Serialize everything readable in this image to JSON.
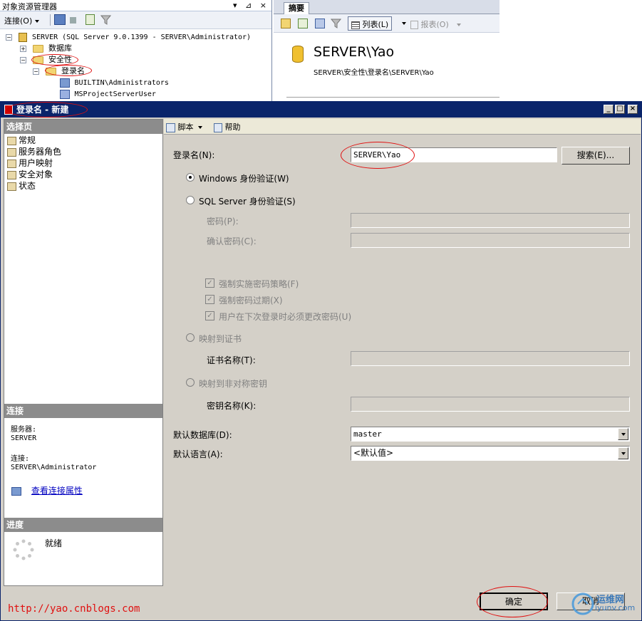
{
  "object_explorer": {
    "title": "对象资源管理器",
    "title_controls": "▾ ⊿ ×",
    "connect_label": "连接(O)",
    "tree": {
      "server": "SERVER (SQL Server 9.0.1399 - SERVER\\Administrator)",
      "databases": "数据库",
      "security": "安全性",
      "logins": "登录名",
      "login1": "BUILTIN\\Administrators",
      "login2": "MSProjectServerUser"
    }
  },
  "summary": {
    "tab_label": "摘要",
    "list_label": "列表(L)",
    "report_label": "报表(O)",
    "heading": "SERVER\\Yao",
    "path": "SERVER\\安全性\\登录名\\SERVER\\Yao"
  },
  "dialog": {
    "title": "登录名 - 新建",
    "select_page_header": "选择页",
    "pages": [
      "常规",
      "服务器角色",
      "用户映射",
      "安全对象",
      "状态"
    ],
    "connection_header": "连接",
    "server_label": "服务器:",
    "server_value": "SERVER",
    "connection_label": "连接:",
    "connection_value": "SERVER\\Administrator",
    "view_conn_props": "查看连接属性",
    "progress_header": "进度",
    "progress_status": "就绪",
    "toolbar": {
      "script_label": "脚本",
      "help_label": "帮助"
    },
    "form": {
      "login_name_label": "登录名(N):",
      "login_name_value": "SERVER\\Yao",
      "search_button": "搜索(E)...",
      "windows_auth": "Windows 身份验证(W)",
      "sql_auth": "SQL Server 身份验证(S)",
      "password_label": "密码(P):",
      "confirm_password_label": "确认密码(C):",
      "enforce_policy": "强制实施密码策略(F)",
      "enforce_expiration": "强制密码过期(X)",
      "must_change": "用户在下次登录时必须更改密码(U)",
      "map_cert": "映射到证书",
      "cert_name_label": "证书名称(T):",
      "map_asym_key": "映射到非对称密钥",
      "key_name_label": "密钥名称(K):",
      "default_db_label": "默认数据库(D):",
      "default_db_value": "master",
      "default_lang_label": "默认语言(A):",
      "default_lang_value": "<默认值>"
    },
    "ok_button": "确定",
    "cancel_button": "取消"
  },
  "footer_url": "http://yao.cnblogs.com",
  "watermark": {
    "line1": "运维网",
    "line2": "iyunv.com"
  }
}
